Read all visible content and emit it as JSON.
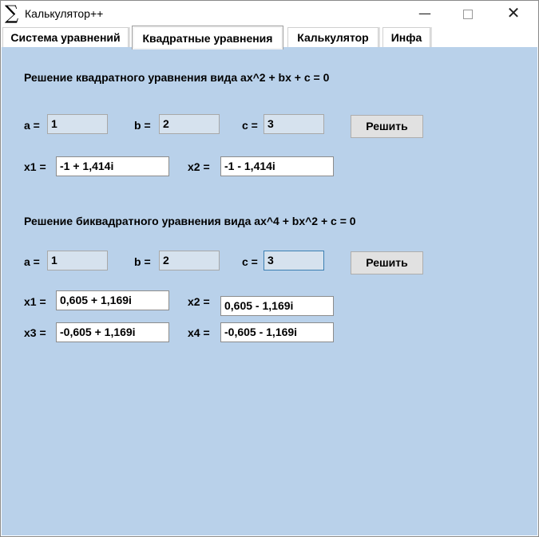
{
  "window": {
    "title": "Калькулятор++",
    "icon_glyph": "∑",
    "controls": {
      "minimize": "—",
      "maximize": "",
      "close": "✕"
    }
  },
  "tabs": [
    {
      "label": "Система уравнений",
      "active": false
    },
    {
      "label": "Квадратные уравнения",
      "active": true
    },
    {
      "label": "Калькулятор",
      "active": false
    },
    {
      "label": "Инфа",
      "active": false
    }
  ],
  "quadratic": {
    "heading": "Решение квадратного уравнения вида ax^2 + bx + c = 0",
    "a_label": "a =",
    "a_value": "1",
    "b_label": "b =",
    "b_value": "2",
    "c_label": "c =",
    "c_value": "3",
    "solve_label": "Решить",
    "x1_label": "x1 =",
    "x1_value": "-1 + 1,414i",
    "x2_label": "x2 =",
    "x2_value": "-1 - 1,414i"
  },
  "biquadratic": {
    "heading": "Решение биквадратного уравнения вида ax^4 + bx^2 + c = 0",
    "a_label": "a =",
    "a_value": "1",
    "b_label": "b =",
    "b_value": "2",
    "c_label": "c =",
    "c_value": "3",
    "solve_label": "Решить",
    "x1_label": "x1 =",
    "x1_value": "0,605 + 1,169i",
    "x2_label": "x2 =",
    "x2_value": "0,605 - 1,169i",
    "x3_label": "x3 =",
    "x3_value": "-0,605 + 1,169i",
    "x4_label": "x4 =",
    "x4_value": "-0,605 - 1,169i"
  },
  "colors": {
    "panel_background": "#b9d1ea",
    "coef_field_background": "#d6e2ee",
    "button_background": "#e1e1e1"
  }
}
